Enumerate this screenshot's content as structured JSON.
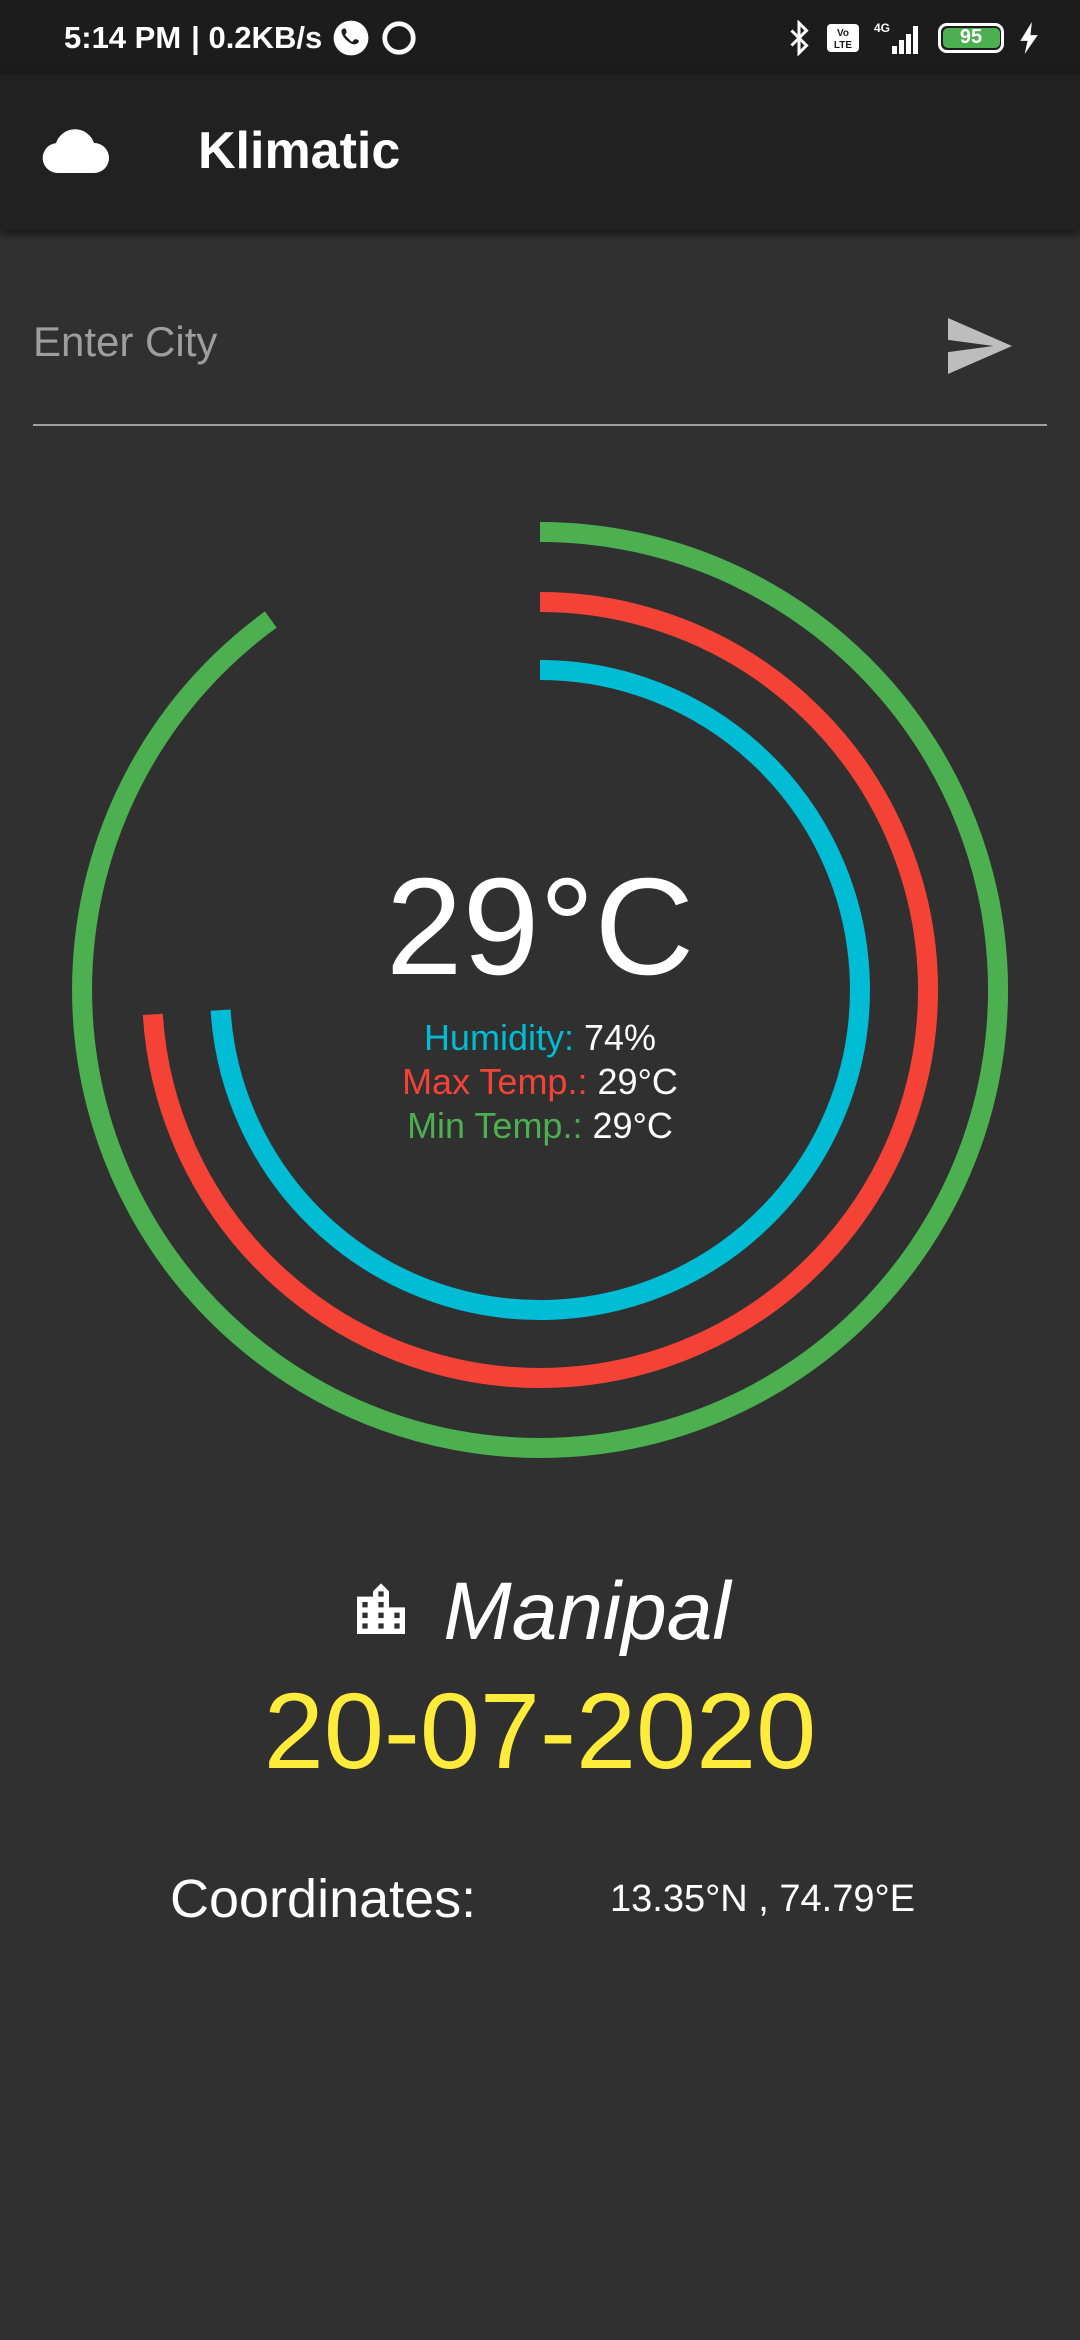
{
  "status_bar": {
    "time": "5:14 PM",
    "speed": "| 0.2KB/s",
    "network_label": "4G",
    "volte_label": "Vo LTE",
    "battery_level": "95",
    "battery_fraction": 0.95
  },
  "app_bar": {
    "title": "Klimatic",
    "logo_icon": "cloud-icon"
  },
  "search": {
    "placeholder": "Enter City",
    "value": "",
    "send_icon": "send-icon"
  },
  "weather": {
    "temperature": "29°C",
    "humidity_label": "Humidity:",
    "humidity_value": "74%",
    "max_label": "Max Temp.:",
    "max_value": "29°C",
    "min_label": "Min Temp.:",
    "min_value": "29°C"
  },
  "gauges": [
    {
      "name": "Humidity",
      "fraction": 0.74,
      "color": "#00bcd4"
    },
    {
      "name": "Max Temp.",
      "fraction": 0.74,
      "color": "#f44336"
    },
    {
      "name": "Min Temp.",
      "fraction": 0.9,
      "color": "#4caf50"
    }
  ],
  "location": {
    "city": "Manipal",
    "city_icon": "city-buildings-icon",
    "date": "20-07-2020",
    "coordinates_label": "Coordinates:",
    "coordinates_value": "13.35°N , 74.79°E"
  },
  "colors": {
    "background": "#303030",
    "app_bar": "#212121",
    "status_bar": "#1c1c1c",
    "humidity": "#00bcd4",
    "max_temp": "#f44336",
    "min_temp": "#4caf50",
    "date": "#ffeb3b"
  }
}
